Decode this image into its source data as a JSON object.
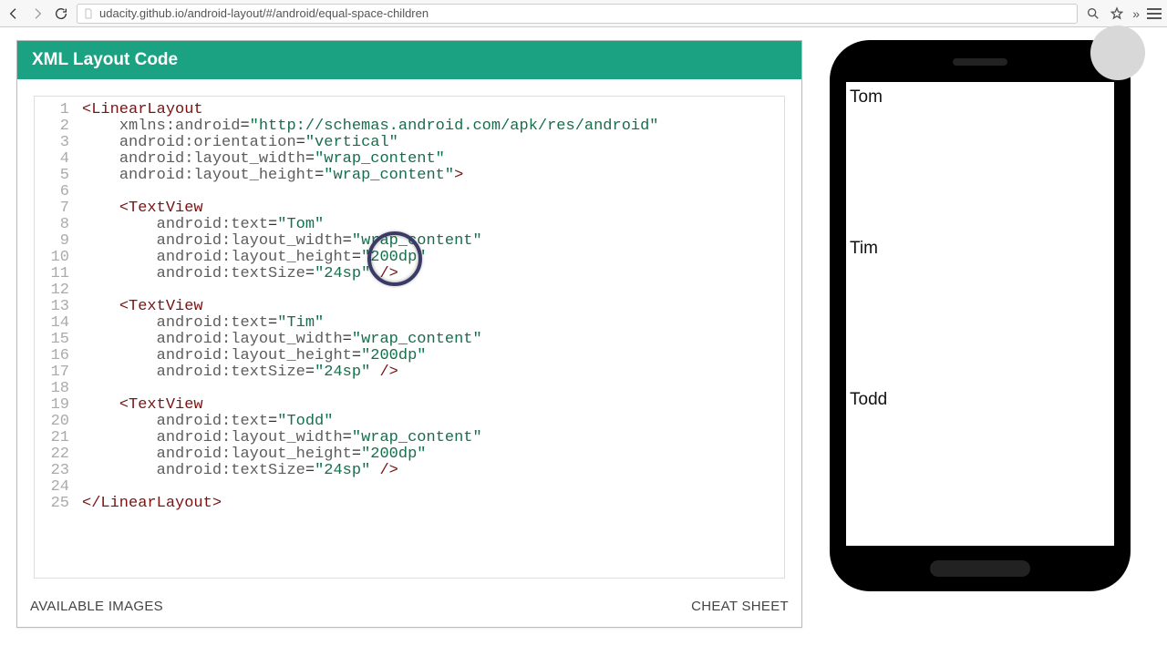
{
  "browser": {
    "url": "udacity.github.io/android-layout/#/android/equal-space-children",
    "chevrons": "»"
  },
  "card": {
    "title": "XML Layout Code"
  },
  "footer": {
    "available": "AVAILABLE IMAGES",
    "cheat": "CHEAT SHEET"
  },
  "phone": {
    "tv1": "Tom",
    "tv2": "Tim",
    "tv3": "Todd"
  },
  "gutter": " 1\n 2\n 3\n 4\n 5\n 6\n 7\n 8\n 9\n10\n11\n12\n13\n14\n15\n16\n17\n18\n19\n20\n21\n22\n23\n24\n25",
  "code": {
    "l1a": "<LinearLayout",
    "attr_xmlns": "xmlns:android",
    "val_xmlns": "\"http://schemas.android.com/apk/res/android\"",
    "attr_orient": "android:orientation",
    "val_vert": "\"vertical\"",
    "attr_w": "android:layout_width",
    "val_wrap": "\"wrap_content\"",
    "attr_h": "android:layout_height",
    "close_gt": ">",
    "tv_open": "<TextView",
    "attr_text": "android:text",
    "val_tom": "\"Tom\"",
    "val_tim": "\"Tim\"",
    "val_todd": "\"Todd\"",
    "val_200": "\"200dp\"",
    "attr_size": "android:textSize",
    "val_24": "\"24sp\"",
    "selfclose": " />",
    "ll_close": "</LinearLayout>",
    "eq": "="
  }
}
